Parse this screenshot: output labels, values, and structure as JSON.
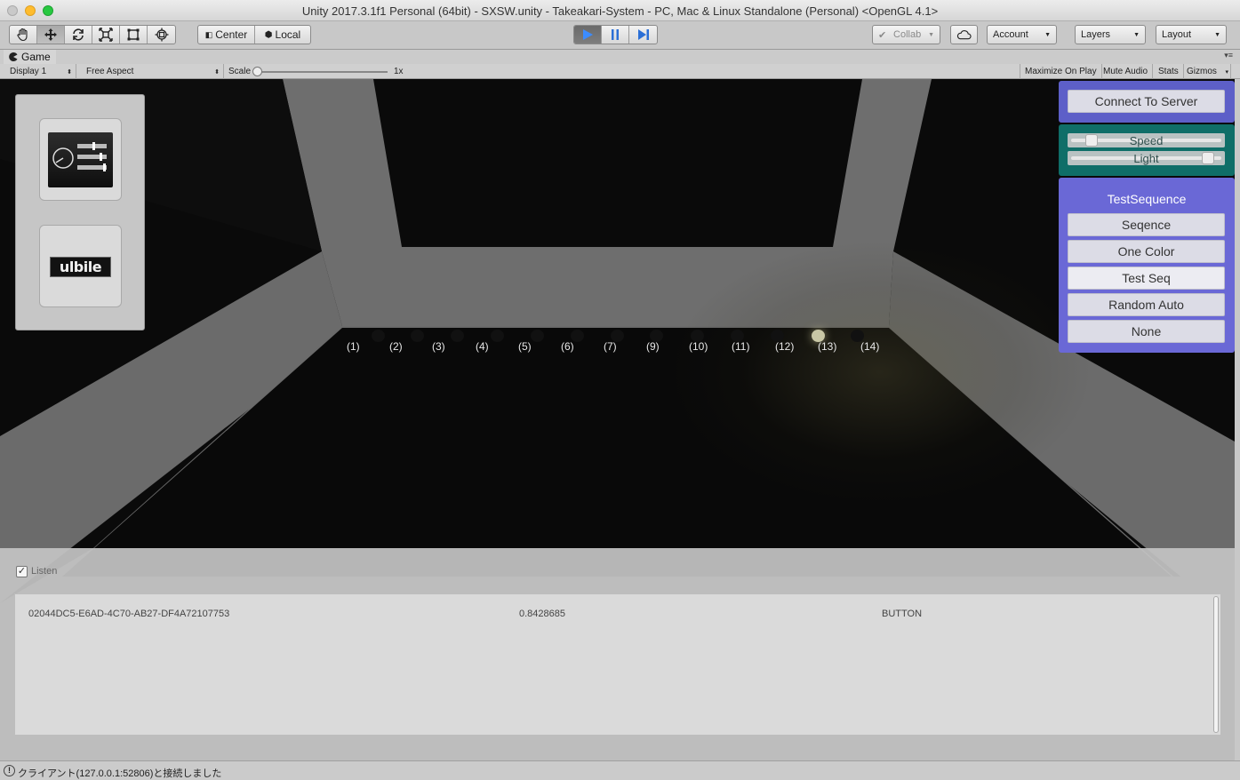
{
  "window": {
    "title": "Unity 2017.3.1f1 Personal (64bit) - SXSW.unity - Takeakari-System - PC, Mac & Linux Standalone (Personal) <OpenGL 4.1>"
  },
  "toolbar": {
    "transform_tools": [
      "hand-icon",
      "move-icon",
      "rotate-icon",
      "scale-icon",
      "rect-icon",
      "transform-icon"
    ],
    "center_label": "Center",
    "local_label": "Local",
    "collab_label": "Collab",
    "account_label": "Account",
    "layers_label": "Layers",
    "layout_label": "Layout"
  },
  "game_tab": {
    "title": "Game",
    "display": "Display 1",
    "aspect": "Free Aspect",
    "scale_label": "Scale",
    "scale_value": "1x",
    "maximize_label": "Maximize On Play",
    "mute_label": "Mute Audio",
    "stats_label": "Stats",
    "gizmos_label": "Gizmos"
  },
  "scene": {
    "node_labels": [
      "(1)",
      "(2)",
      "(3)",
      "(4)",
      "(5)",
      "(6)",
      "(7)",
      "(9)",
      "(10)",
      "(11)",
      "(12)",
      "(13)",
      "(14)"
    ],
    "lit_node": "(13)"
  },
  "left_panel": {
    "brand_text": "ulbile"
  },
  "right_panel": {
    "connect_label": "Connect To Server",
    "speed_label": "Speed",
    "light_label": "Light",
    "speed_value": 0.1,
    "light_value": 0.95,
    "sequence_title": "TestSequence",
    "sequence_buttons": [
      "Seqence",
      "One Color",
      "Test Seq",
      "Random Auto",
      "None"
    ]
  },
  "listen_panel": {
    "listen_label": "Listen",
    "listen_checked": true,
    "log_rows": [
      {
        "id": "02044DC5-E6AD-4C70-AB27-DF4A72107753",
        "value": "0.8428685",
        "type": "BUTTON"
      }
    ]
  },
  "status": {
    "message": "クライアント(127.0.0.1:52806)と接続しました"
  }
}
